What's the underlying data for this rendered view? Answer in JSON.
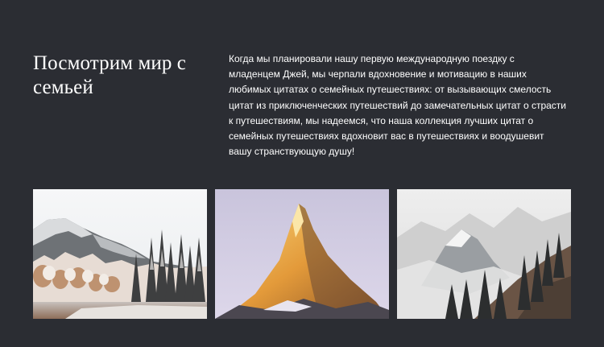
{
  "section": {
    "title": "Посмотрим мир с семьей",
    "body": "Когда мы планировали нашу первую международную поездку с младенцем Джей, мы черпали вдохновение и мотивацию в наших любимых цитатах о семейных путешествиях: от вызывающих смелость цитат из приключенческих путешествий до замечательных цитат о страсти к путешествиям, мы надеемся, что наша коллекция лучших цитат о семейных путешествиях вдохновит вас в путешествиях и воодушевит вашу странствующую душу!"
  },
  "colors": {
    "background": "#2b2d33",
    "text": "#ffffff"
  },
  "gallery": {
    "images": [
      {
        "name": "winter-forest-mountain-photo"
      },
      {
        "name": "golden-peak-photo"
      },
      {
        "name": "misty-mountains-photo"
      }
    ]
  }
}
